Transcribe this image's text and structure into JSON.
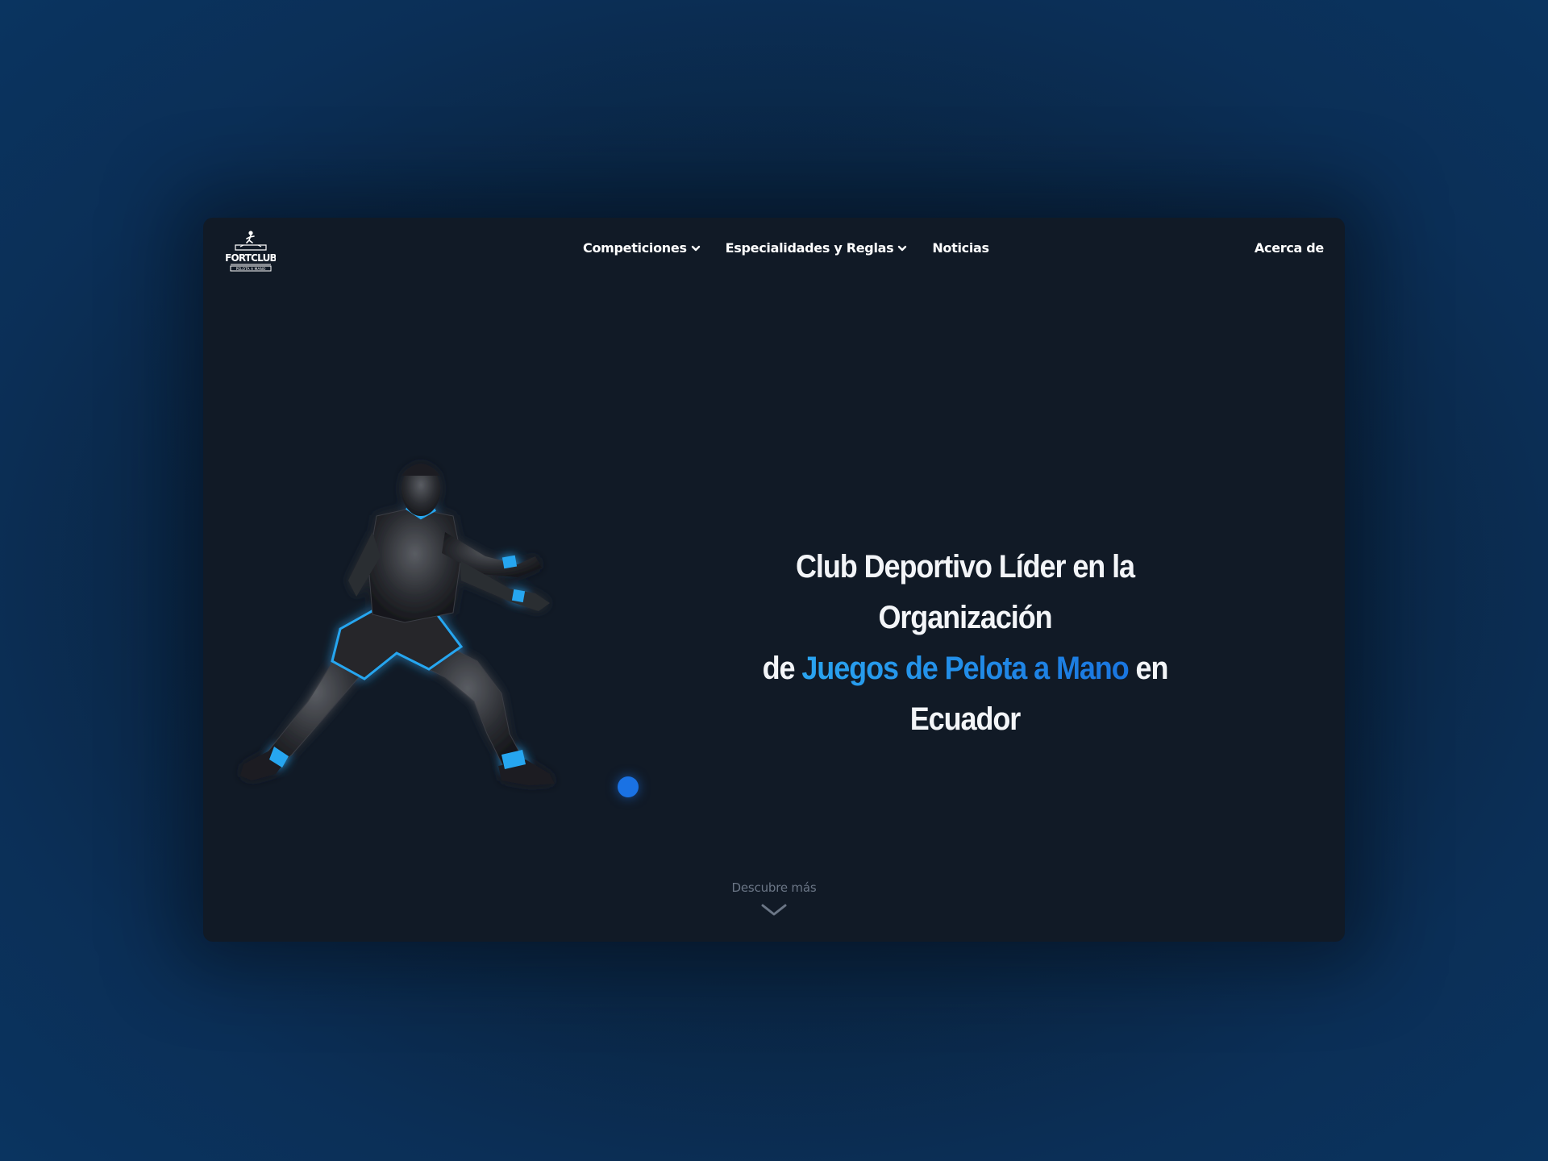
{
  "brand": {
    "logo_text": "FORTCLUB",
    "logo_subtext": "PELOTA A MANO"
  },
  "nav": {
    "items": [
      {
        "label": "Competiciones",
        "has_dropdown": true,
        "icon": "chevron-down-icon"
      },
      {
        "label": "Especialidades y Reglas",
        "has_dropdown": true,
        "icon": "chevron-down-icon"
      },
      {
        "label": "Noticias",
        "has_dropdown": false
      }
    ],
    "right_link": "Acerca de"
  },
  "hero": {
    "headline_line1": "Club Deportivo Líder en la Organización",
    "headline_line2_prefix": "de ",
    "headline_highlight": "Juegos de Pelota a Mano",
    "headline_line2_suffix": " en Ecuador",
    "image": "pelota-player-illustration"
  },
  "discover": {
    "label": "Descubre más",
    "icon": "chevron-down-icon"
  },
  "colors": {
    "page_bg": "#0a2a4c",
    "card_bg": "#111a26",
    "accent": "#1a8ae8",
    "ball": "#1a72e4",
    "player_trim": "#27a6f0",
    "text": "#ffffff",
    "muted": "#6b7686"
  }
}
